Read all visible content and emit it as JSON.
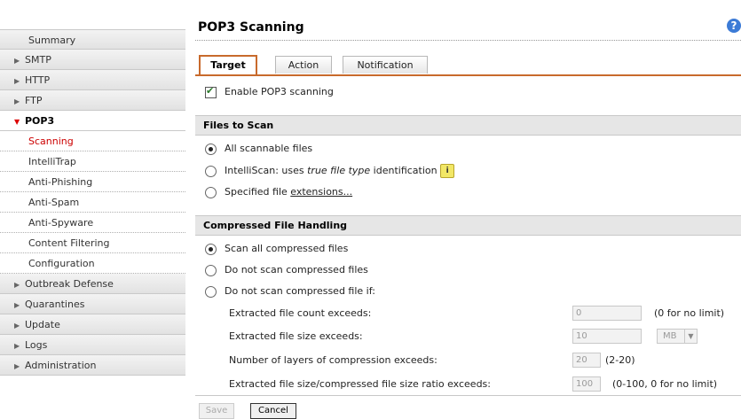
{
  "sidebar": {
    "summary": "Summary",
    "items": [
      {
        "label": "SMTP"
      },
      {
        "label": "HTTP"
      },
      {
        "label": "FTP"
      },
      {
        "label": "POP3"
      }
    ],
    "pop3_sub": [
      {
        "label": "Scanning"
      },
      {
        "label": "IntelliTrap"
      },
      {
        "label": "Anti-Phishing"
      },
      {
        "label": "Anti-Spam"
      },
      {
        "label": "Anti-Spyware"
      },
      {
        "label": "Content Filtering"
      },
      {
        "label": "Configuration"
      }
    ],
    "lower": [
      {
        "label": "Outbreak Defense"
      },
      {
        "label": "Quarantines"
      },
      {
        "label": "Update"
      },
      {
        "label": "Logs"
      },
      {
        "label": "Administration"
      }
    ]
  },
  "page": {
    "title": "POP3 Scanning",
    "help": "?"
  },
  "tabs": [
    {
      "label": "Target"
    },
    {
      "label": "Action"
    },
    {
      "label": "Notification"
    }
  ],
  "enable": {
    "label": "Enable POP3 scanning",
    "checked": true
  },
  "files_to_scan": {
    "heading": "Files to Scan",
    "options": {
      "all": "All scannable files",
      "intelliscan_prefix": "IntelliScan: uses ",
      "intelliscan_italic": "true file type",
      "intelliscan_suffix": " identification",
      "specified_prefix": "Specified file ",
      "specified_link": "extensions..."
    }
  },
  "compressed": {
    "heading": "Compressed File Handling",
    "options": {
      "scan_all": "Scan all compressed files",
      "do_not_scan": "Do not scan compressed files",
      "do_not_scan_if": "Do not scan compressed file if:"
    },
    "conditions": [
      {
        "label": "Extracted file count exceeds:",
        "value": "0",
        "hint": "(0 for no limit)"
      },
      {
        "label": "Extracted file size exceeds:",
        "value": "10",
        "unit": "MB"
      },
      {
        "label": "Number of layers of compression exceeds:",
        "value": "20",
        "hint": "(2-20)"
      },
      {
        "label": "Extracted file size/compressed file size ratio exceeds:",
        "value": "100",
        "hint": "(0-100, 0 for no limit)"
      }
    ]
  },
  "buttons": {
    "save": "Save",
    "cancel": "Cancel"
  },
  "colors": {
    "accent": "#c86a2c",
    "active_link": "#cc0000",
    "section_bg": "#e6e6e6"
  }
}
